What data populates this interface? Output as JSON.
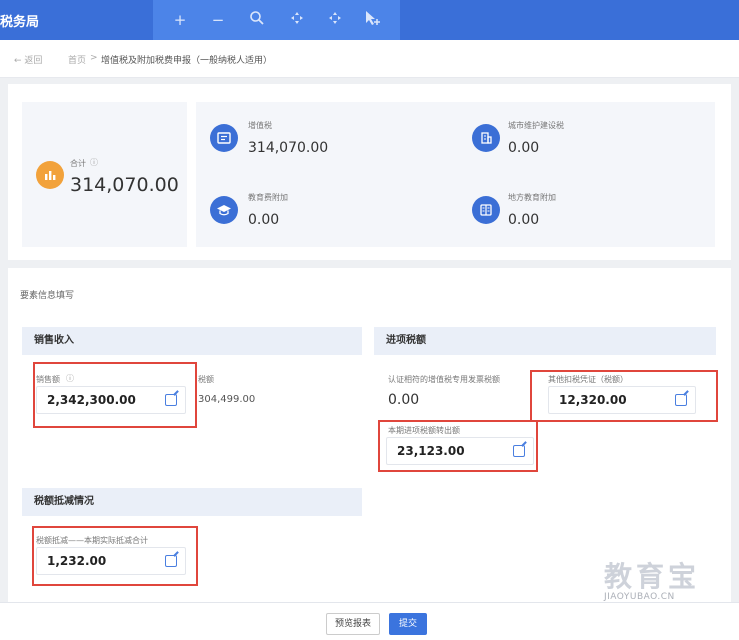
{
  "app": {
    "title": "税务局"
  },
  "zoom_toolbar": [
    "+",
    "−",
    "🔍",
    "✥",
    "✥",
    "▸+"
  ],
  "breadcrumb": {
    "back": "← 返回",
    "home": "首页",
    "sep": ">",
    "current": "增值税及附加税费申报（一般纳税人适用）"
  },
  "summary": {
    "total_label": "合计",
    "total_value": "314,070.00",
    "items": [
      {
        "label": "增值税",
        "value": "314,070.00"
      },
      {
        "label": "城市维护建设税",
        "value": "0.00"
      },
      {
        "label": "教育费附加",
        "value": "0.00"
      },
      {
        "label": "地方教育附加",
        "value": "0.00"
      }
    ]
  },
  "section": {
    "title": "要素信息填写",
    "sales": {
      "heading": "销售收入",
      "amount_label": "销售额",
      "amount_value": "2,342,300.00",
      "tax_label": "税额",
      "tax_value": "304,499.00"
    },
    "input_tax": {
      "heading": "进项税额",
      "certified_label": "认证相符的增值税专用发票税额",
      "certified_value": "0.00",
      "other_label": "其他扣税凭证（税额）",
      "other_value": "12,320.00",
      "transfer_label": "本期进项税额转出额",
      "transfer_value": "23,123.00"
    },
    "deduction": {
      "heading": "税额抵减情况",
      "label": "税额抵减——本期实际抵减合计",
      "value": "1,232.00"
    }
  },
  "footer": {
    "preview": "预览报表",
    "submit": "提交"
  },
  "watermark": {
    "big": "教育宝",
    "small": "JIAOYUBAO.CN"
  },
  "colors": {
    "primary": "#3b74de",
    "orange": "#f2a23b",
    "highlight": "#e0463c"
  }
}
